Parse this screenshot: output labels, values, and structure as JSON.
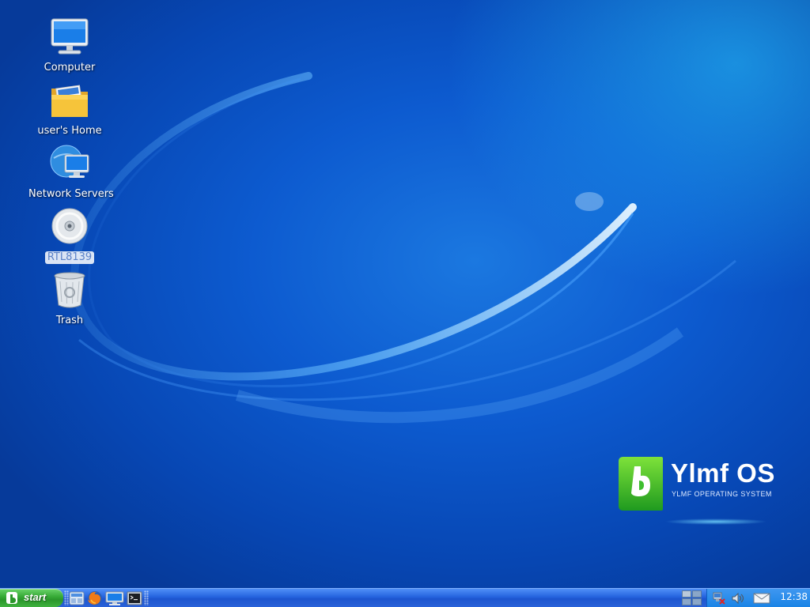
{
  "desktop": {
    "icons": [
      {
        "label": "Computer",
        "icon": "computer-icon"
      },
      {
        "label": "user's Home",
        "icon": "home-folder-icon"
      },
      {
        "label": "Network Servers",
        "icon": "network-servers-icon"
      },
      {
        "label": "RTL8139",
        "icon": "cd-drive-icon",
        "selected": true
      },
      {
        "label": "Trash",
        "icon": "trash-icon"
      }
    ]
  },
  "logo": {
    "brand": "Ylmf OS",
    "subtitle": "YLMF OPERATING SYSTEM"
  },
  "taskbar": {
    "start_label": "start",
    "quick_launch": [
      "file-manager-icon",
      "firefox-icon",
      "show-desktop-icon",
      "terminal-icon"
    ],
    "tray": {
      "icons": [
        "network-icon",
        "volume-icon",
        "mail-icon"
      ],
      "clock": "12:38"
    }
  },
  "colors": {
    "desktop_bg": "#0b46b8",
    "taskbar": "#2563de",
    "start_button": "#35a835",
    "accent": "#1b78e0"
  }
}
